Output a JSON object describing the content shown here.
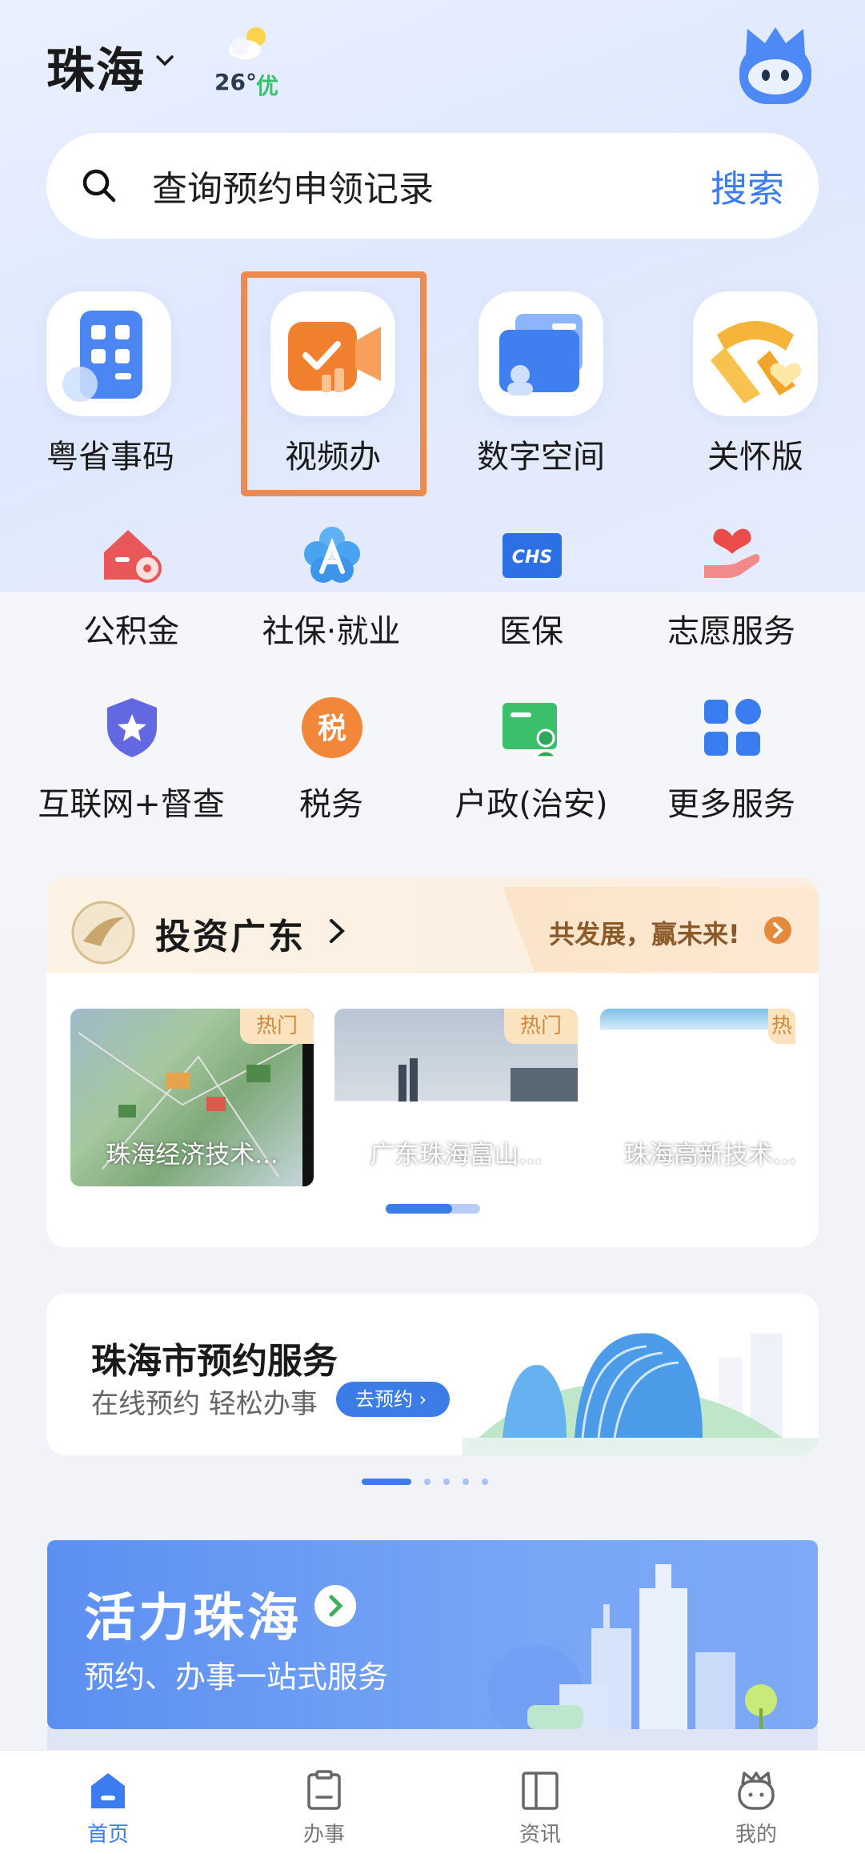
{
  "header": {
    "city": "珠海",
    "temperature": "26°",
    "air_quality": "优"
  },
  "search": {
    "placeholder": "查询预约申领记录",
    "button_label": "搜索"
  },
  "quick_services": [
    {
      "label": "粤省事码",
      "icon": "qr-code-icon"
    },
    {
      "label": "视频办",
      "icon": "video-camera-icon"
    },
    {
      "label": "数字空间",
      "icon": "wallet-folder-icon"
    },
    {
      "label": "关怀版",
      "icon": "scarf-heart-icon"
    }
  ],
  "service_grid": [
    {
      "label": "公积金",
      "icon": "house-coin-icon"
    },
    {
      "label": "社保·就业",
      "icon": "shield-flower-icon"
    },
    {
      "label": "医保",
      "icon": "chs-card-icon"
    },
    {
      "label": "志愿服务",
      "icon": "heart-hand-icon"
    },
    {
      "label": "互联网+督查",
      "icon": "star-shield-icon"
    },
    {
      "label": "税务",
      "icon": "tax-icon"
    },
    {
      "label": "户政(治安)",
      "icon": "id-card-icon"
    },
    {
      "label": "更多服务",
      "icon": "grid-apps-icon"
    }
  ],
  "invest": {
    "title": "投资广东",
    "slogan": "共发展，赢未来!",
    "items": [
      {
        "caption": "珠海经济技术...",
        "badge": "热门"
      },
      {
        "caption": "广东珠海富山...",
        "badge": "热门"
      },
      {
        "caption": "珠海高新技术...",
        "badge": "热"
      }
    ],
    "carousel_progress": 0.7
  },
  "appointment": {
    "title": "珠海市预约服务",
    "subtitle": "在线预约 轻松办事",
    "button_label": "去预约"
  },
  "vitality": {
    "title": "活力珠海",
    "subtitle": "预约、办事一站式服务"
  },
  "tabbar": {
    "tabs": [
      {
        "label": "首页",
        "icon": "home-icon",
        "active": true
      },
      {
        "label": "办事",
        "icon": "clipboard-icon",
        "active": false
      },
      {
        "label": "资讯",
        "icon": "news-icon",
        "active": false
      },
      {
        "label": "我的",
        "icon": "profile-mascot-icon",
        "active": false
      }
    ]
  },
  "colors": {
    "accent": "#3b7cf0",
    "highlight_border": "#ef8a4f",
    "aqi_good": "#3cbf6b"
  }
}
